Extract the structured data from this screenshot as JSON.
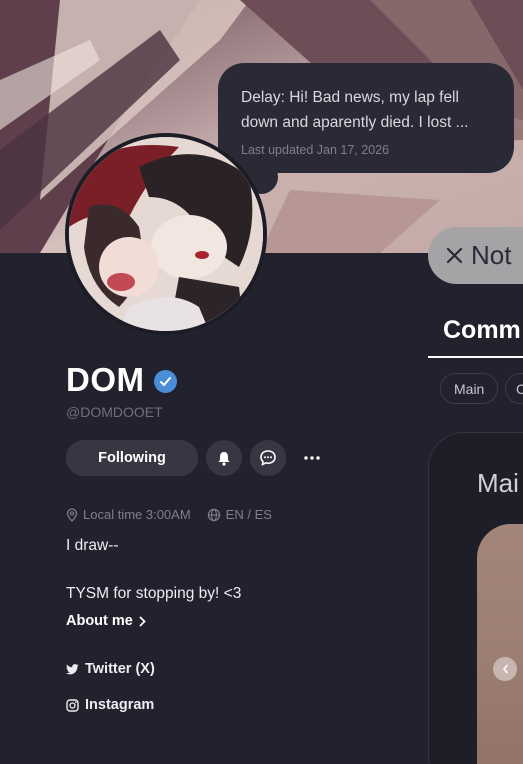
{
  "status": {
    "text": "Delay: Hi! Bad news, my lap fell down and aparently died. I lost ...",
    "updated": "Last updated Jan 17, 2026"
  },
  "profile": {
    "name": "DOM",
    "handle": "@DOMDOOET",
    "verified": true,
    "following_label": "Following",
    "local_time": "Local time 3:00AM",
    "languages": "EN / ES",
    "bio_line1": "I draw--",
    "bio_line2": "TYSM for stopping by! <3",
    "about_label": "About me",
    "links": [
      {
        "label": "Twitter (X)",
        "icon": "twitter-icon"
      },
      {
        "label": "Instagram",
        "icon": "instagram-icon"
      }
    ]
  },
  "right": {
    "pill_label": "Not",
    "tab_label": "Comm",
    "chips": [
      "Main",
      "C"
    ],
    "card_title": "Mai"
  },
  "colors": {
    "background": "#22222e",
    "verified": "#4a8ed8",
    "button": "#373744"
  }
}
